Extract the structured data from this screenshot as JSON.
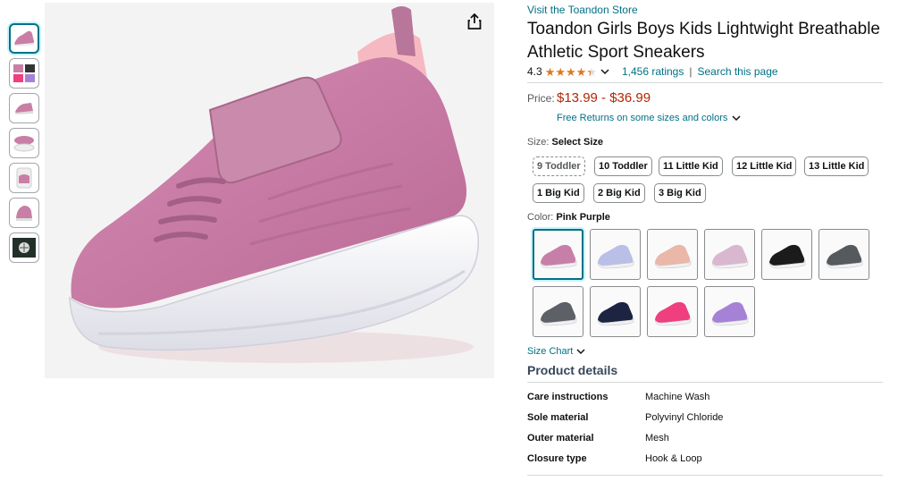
{
  "store_link": "Visit the Toandon Store",
  "title": "Toandon Girls Boys Kids Lightwight Breathable Athletic Sport Sneakers",
  "rating": {
    "value": "4.3",
    "stars": 4.3,
    "count_text": "1,456 ratings",
    "separator": "|",
    "search_text": "Search this page"
  },
  "price": {
    "label": "Price:",
    "range": "$13.99 - $36.99",
    "returns": "Free Returns on some sizes and colors"
  },
  "size": {
    "label": "Size:",
    "selected": "Select Size",
    "options": [
      "9 Toddler",
      "10 Toddler",
      "11 Little Kid",
      "12 Little Kid",
      "13 Little Kid",
      "1 Big Kid",
      "2 Big Kid",
      "3 Big Kid"
    ]
  },
  "color": {
    "label": "Color:",
    "selected": "Pink Purple",
    "swatches": [
      "#c77fa8",
      "#b9bfe6",
      "#eab7a8",
      "#d9b8cf",
      "#1b1b1b",
      "#555a5e",
      "#5d6066",
      "#1c2442",
      "#ef3f7f",
      "#a682d6"
    ]
  },
  "size_chart": "Size Chart",
  "product_details": {
    "title": "Product details",
    "rows": [
      {
        "key": "Care instructions",
        "value": "Machine Wash"
      },
      {
        "key": "Sole material",
        "value": "Polyvinyl Chloride"
      },
      {
        "key": "Outer material",
        "value": "Mesh"
      },
      {
        "key": "Closure type",
        "value": "Hook & Loop"
      }
    ]
  },
  "colors": {
    "link": "#007185",
    "price": "#b12704",
    "star": "#de7921",
    "shoe_main": "#c97ea6",
    "sole": "#f2f2f6"
  }
}
